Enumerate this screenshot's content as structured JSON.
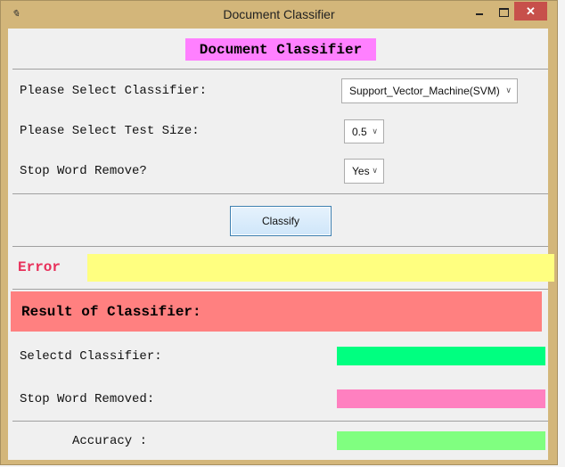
{
  "window": {
    "title": "Document Classifier",
    "colors": {
      "frame": "#d3b67a",
      "close": "#c7504b"
    }
  },
  "header": {
    "title": "Document Classifier",
    "color": "#ff80ff"
  },
  "form": {
    "classifier_label": "Please Select Classifier:",
    "classifier_value": "Support_Vector_Machine(SVM)",
    "test_size_label": "Please Select Test Size:",
    "test_size_value": "0.5",
    "stopword_label": "Stop Word Remove?",
    "stopword_value": "Yes"
  },
  "actions": {
    "classify_label": "Classify"
  },
  "error": {
    "label": "Error",
    "value": "",
    "colors": {
      "label": "#e8305a",
      "field": "#ffff80"
    }
  },
  "result": {
    "title": "Result of Classifier:",
    "selected_label": "Selectd Classifier:",
    "selected_value": "",
    "stopword_label": "Stop Word Removed:",
    "stopword_value": "",
    "accuracy_label": "Accuracy :",
    "accuracy_value": "",
    "colors": {
      "title": "#ff8080",
      "selected": "#00ff80",
      "stopword": "#ff80c0",
      "accuracy": "#80ff80"
    }
  }
}
